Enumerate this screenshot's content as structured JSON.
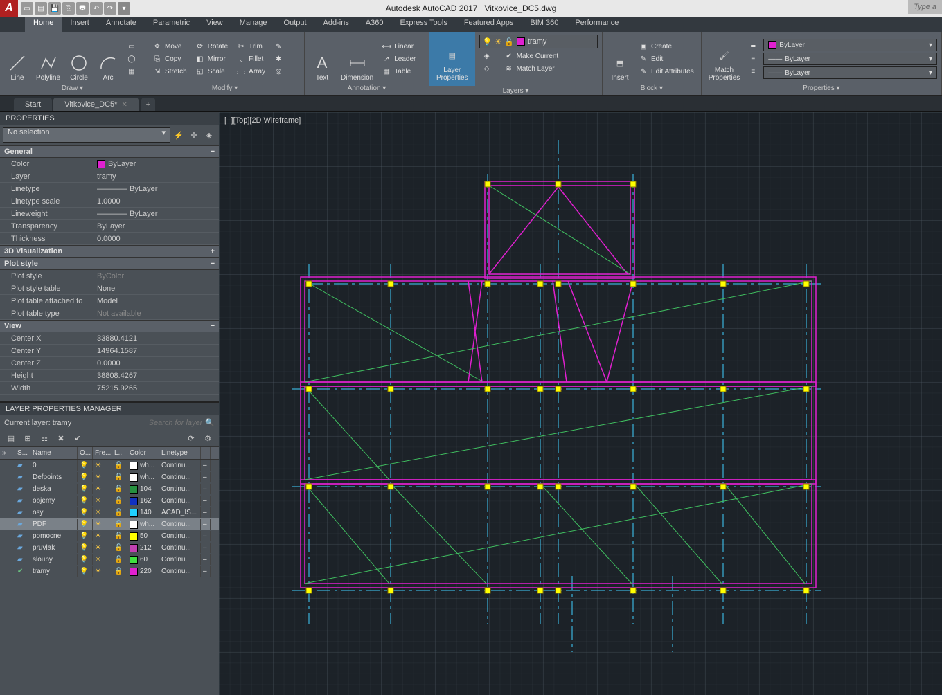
{
  "app": {
    "title": "Autodesk AutoCAD 2017",
    "file": "Vitkovice_DC5.dwg",
    "type_hint": "Type a"
  },
  "ribbon_tabs": [
    "Home",
    "Insert",
    "Annotate",
    "Parametric",
    "View",
    "Manage",
    "Output",
    "Add-ins",
    "A360",
    "Express Tools",
    "Featured Apps",
    "BIM 360",
    "Performance"
  ],
  "active_ribbon_tab": "Home",
  "ribbon": {
    "draw": {
      "title": "Draw ▾",
      "line": "Line",
      "polyline": "Polyline",
      "circle": "Circle",
      "arc": "Arc"
    },
    "modify": {
      "title": "Modify ▾",
      "move": "Move",
      "copy": "Copy",
      "stretch": "Stretch",
      "rotate": "Rotate",
      "mirror": "Mirror",
      "scale": "Scale",
      "trim": "Trim",
      "fillet": "Fillet",
      "array": "Array"
    },
    "annotation": {
      "title": "Annotation ▾",
      "text": "Text",
      "dimension": "Dimension",
      "linear": "Linear",
      "leader": "Leader",
      "table": "Table"
    },
    "layers": {
      "title": "Layers ▾",
      "properties": "Layer\nProperties",
      "combo": "tramy",
      "make_current": "Make Current",
      "match_layer": "Match Layer"
    },
    "block": {
      "title": "Block ▾",
      "insert": "Insert",
      "create": "Create",
      "edit": "Edit",
      "edit_attr": "Edit Attributes"
    },
    "properties": {
      "title": "Properties ▾",
      "match": "Match\nProperties",
      "color": "ByLayer",
      "lw": "ByLayer",
      "lt": "ByLayer"
    }
  },
  "doc_tabs": {
    "start": "Start",
    "active": "Vitkovice_DC5*"
  },
  "props_panel": {
    "title": "PROPERTIES",
    "selection": "No selection",
    "sections": {
      "general": {
        "head": "General",
        "rows": [
          {
            "k": "Color",
            "v": "ByLayer",
            "sw": "#e020d0"
          },
          {
            "k": "Layer",
            "v": "tramy"
          },
          {
            "k": "Linetype",
            "v": "———— ByLayer"
          },
          {
            "k": "Linetype scale",
            "v": "1.0000"
          },
          {
            "k": "Lineweight",
            "v": "———— ByLayer"
          },
          {
            "k": "Transparency",
            "v": "ByLayer"
          },
          {
            "k": "Thickness",
            "v": "0.0000"
          }
        ]
      },
      "viz": {
        "head": "3D Visualization"
      },
      "plot": {
        "head": "Plot style",
        "rows": [
          {
            "k": "Plot style",
            "v": "ByColor",
            "dim": true
          },
          {
            "k": "Plot style table",
            "v": "None"
          },
          {
            "k": "Plot table attached to",
            "v": "Model"
          },
          {
            "k": "Plot table type",
            "v": "Not available",
            "dim": true
          }
        ]
      },
      "view": {
        "head": "View",
        "rows": [
          {
            "k": "Center X",
            "v": "33880.4121"
          },
          {
            "k": "Center Y",
            "v": "14964.1587"
          },
          {
            "k": "Center Z",
            "v": "0.0000"
          },
          {
            "k": "Height",
            "v": "38808.4267"
          },
          {
            "k": "Width",
            "v": "75215.9265"
          }
        ]
      }
    }
  },
  "layer_mgr": {
    "title": "LAYER PROPERTIES MANAGER",
    "current": "Current layer: tramy",
    "search_placeholder": "Search for layer",
    "columns": [
      "S...",
      "Name",
      "O...",
      "Fre...",
      "L...",
      "Color",
      "Linetype"
    ],
    "layers": [
      {
        "name": "0",
        "color": "#ffffff",
        "cname": "wh...",
        "lt": "Continu..."
      },
      {
        "name": "Defpoints",
        "color": "#ffffff",
        "cname": "wh...",
        "lt": "Continu..."
      },
      {
        "name": "deska",
        "color": "#269040",
        "cname": "104",
        "lt": "Continu..."
      },
      {
        "name": "objemy",
        "color": "#1030c0",
        "cname": "162",
        "lt": "Continu..."
      },
      {
        "name": "osy",
        "color": "#20d0ff",
        "cname": "140",
        "lt": "ACAD_IS..."
      },
      {
        "name": "PDF",
        "color": "#ffffff",
        "cname": "wh...",
        "lt": "Continu...",
        "selected": true,
        "frozen": true
      },
      {
        "name": "pomocne",
        "color": "#ffff00",
        "cname": "50",
        "lt": "Continu..."
      },
      {
        "name": "pruvlak",
        "color": "#c040b0",
        "cname": "212",
        "lt": "Continu..."
      },
      {
        "name": "sloupy",
        "color": "#40e040",
        "cname": "60",
        "lt": "Continu..."
      },
      {
        "name": "tramy",
        "color": "#e020d0",
        "cname": "220",
        "lt": "Continu...",
        "current": true
      }
    ]
  },
  "viewport_label": "[−][Top][2D Wireframe]"
}
